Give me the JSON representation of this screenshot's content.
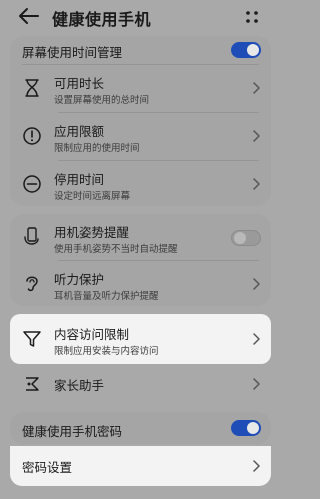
{
  "header": {
    "title": "健康使用手机",
    "back_icon": "back-arrow-icon",
    "more_icon": "more-dots-icon"
  },
  "screen_time": {
    "label": "屏幕使用时间管理",
    "enabled": true,
    "items": [
      {
        "label": "可用时长",
        "sub": "设置屏幕使用的总时间",
        "icon": "hourglass-icon"
      },
      {
        "label": "应用限额",
        "sub": "限制应用的使用时间",
        "icon": "exclamation-circle-icon"
      },
      {
        "label": "停用时间",
        "sub": "设定时间远离屏幕",
        "icon": "minus-circle-icon"
      }
    ]
  },
  "posture": {
    "label": "用机姿势提醒",
    "sub": "使用手机姿势不当时自动提醒",
    "enabled": false,
    "icon": "phone-hand-icon"
  },
  "hearing": {
    "label": "听力保护",
    "sub": "耳机音量及听力保护提醒",
    "icon": "ear-icon"
  },
  "content": {
    "label": "内容访问限制",
    "sub": "限制应用安装与内容访问",
    "icon": "filter-icon"
  },
  "parent": {
    "label": "家长助手",
    "icon": "parent-assistant-icon"
  },
  "password": {
    "toggle_label": "健康使用手机密码",
    "enabled": true,
    "settings_label": "密码设置"
  },
  "colors": {
    "accent": "#1f4db8",
    "dim_background": "#a9a9a9",
    "highlight_background": "#f3f3f3"
  }
}
